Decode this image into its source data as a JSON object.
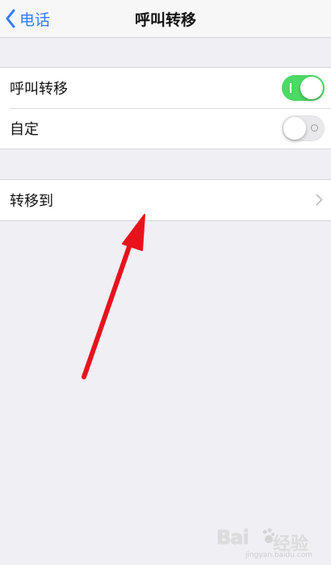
{
  "navbar": {
    "back_label": "电话",
    "title": "呼叫转移"
  },
  "group1": {
    "rows": [
      {
        "label": "呼叫转移",
        "toggle_on": true
      },
      {
        "label": "自定",
        "toggle_on": false
      }
    ]
  },
  "group2": {
    "rows": [
      {
        "label": "转移到"
      }
    ]
  },
  "colors": {
    "accent": "#2f7cf6",
    "toggle_on": "#4cd964",
    "arrow": "#e8121d",
    "background": "#efeff4"
  },
  "icons": {
    "back": "chevron-left-icon",
    "disclosure": "chevron-right-icon",
    "annotation": "red-arrow-icon"
  },
  "watermark": {
    "brand": "Bai",
    "suffix": "经验",
    "url": "jingyan.baidu.com"
  }
}
